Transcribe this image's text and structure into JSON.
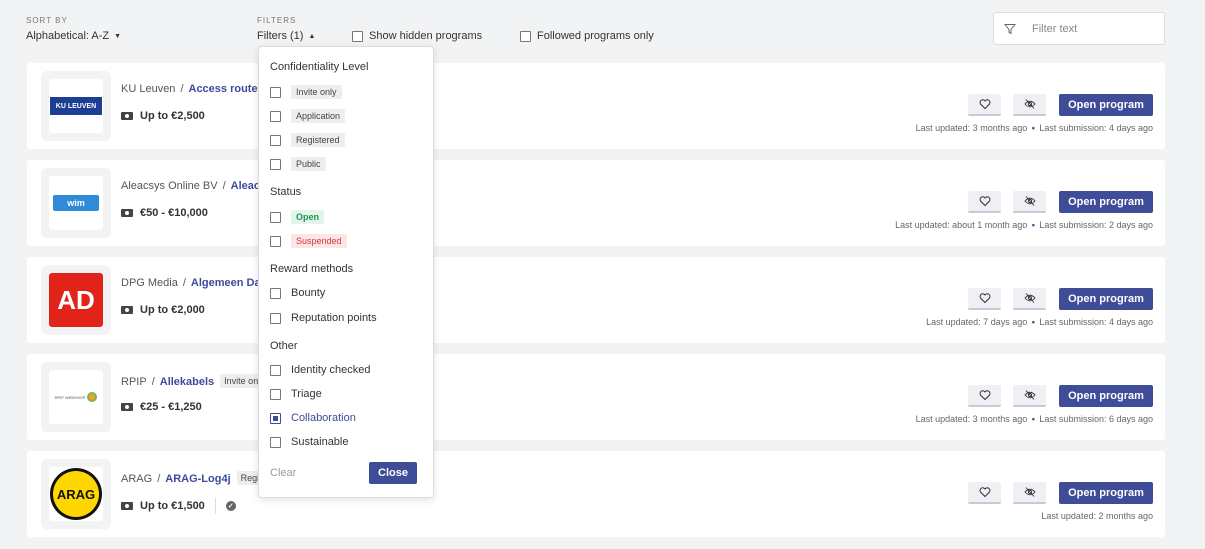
{
  "topbar": {
    "sort_label": "SORT BY",
    "sort_value": "Alphabetical: A-Z",
    "filters_label": "FILTERS",
    "filters_toggle": "Filters (1)",
    "show_hidden": "Show hidden programs",
    "followed_only": "Followed programs only",
    "filter_placeholder": "Filter text"
  },
  "cards": [
    {
      "org": "KU Leuven",
      "program": "Access router",
      "reward": "Up to €2,500",
      "meta_updated": "Last updated: 3 months ago",
      "meta_submission": "Last submission: 4 days ago",
      "logo_text": "KU LEUVEN"
    },
    {
      "org": "Aleacsys Online BV",
      "program": "Aleacsys",
      "reward": "€50 - €10,000",
      "meta_updated": "Last updated: about 1 month ago",
      "meta_submission": "Last submission: 2 days ago",
      "logo_text": "wim"
    },
    {
      "org": "DPG Media",
      "program": "Algemeen Dagblad",
      "reward": "Up to €2,000",
      "meta_updated": "Last updated: 7 days ago",
      "meta_submission": "Last submission: 4 days ago",
      "logo_text": "AD"
    },
    {
      "org": "RPIP",
      "program": "Allekabels",
      "level": "Invite only",
      "reward": "€25 - €1,250",
      "meta_updated": "Last updated: 3 months ago",
      "meta_submission": "Last submission: 6 days ago",
      "logo_text": "RPIP WEBSHOP"
    },
    {
      "org": "ARAG",
      "program": "ARAG-Log4j",
      "level": "Registered",
      "reward": "Up to €1,500",
      "meta_updated": "Last updated: 2 months ago",
      "logo_text": "ARAG"
    }
  ],
  "card_common": {
    "sep": "/",
    "open_label": "Open program",
    "dot": "•"
  },
  "dropdown": {
    "confidentiality_title": "Confidentiality Level",
    "confidentiality": [
      "Invite only",
      "Application",
      "Registered",
      "Public"
    ],
    "status_title": "Status",
    "status": [
      "Open",
      "Suspended"
    ],
    "reward_title": "Reward methods",
    "reward": [
      "Bounty",
      "Reputation points"
    ],
    "other_title": "Other",
    "other": [
      "Identity checked",
      "Triage",
      "Collaboration",
      "Sustainable"
    ],
    "selected": "Collaboration",
    "clear_label": "Clear",
    "close_label": "Close"
  },
  "colors": {
    "accent": "#3f4c98",
    "open_status": "#27915a",
    "suspended_status": "#d23a47"
  }
}
